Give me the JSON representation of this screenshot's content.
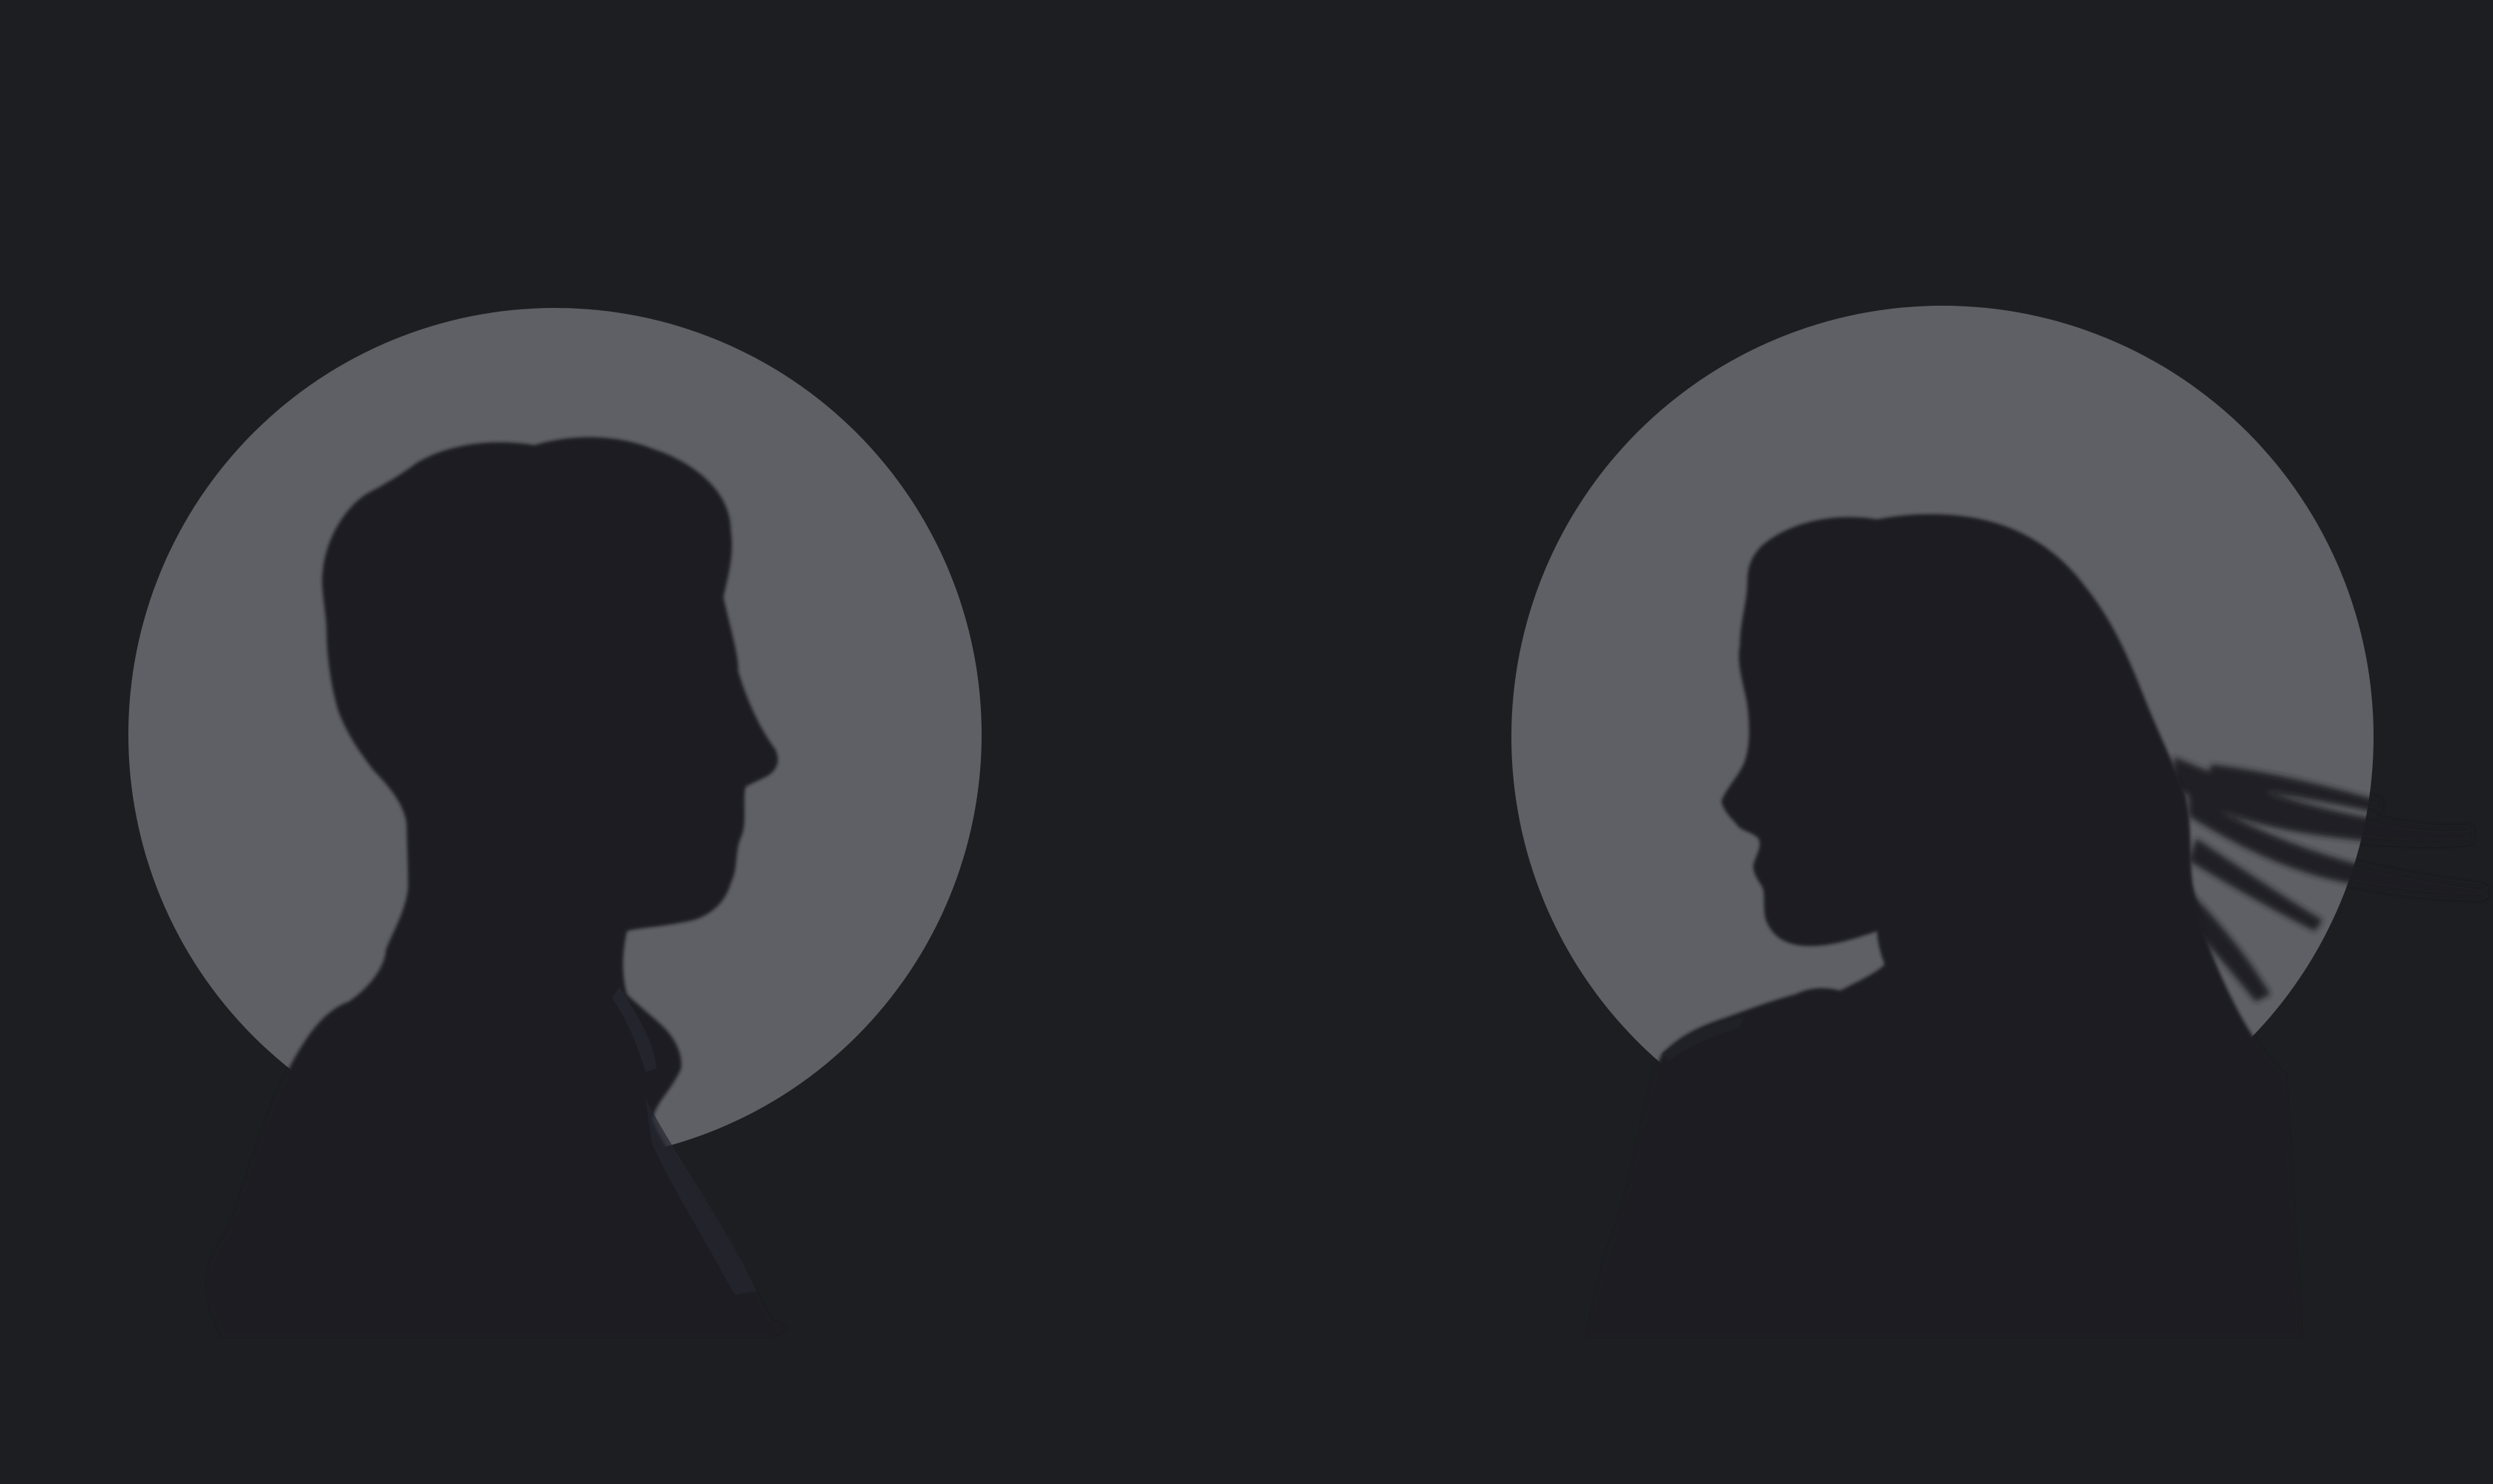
{
  "scene": {
    "background_color": "#1d1e22",
    "disc_color": "#5f6065",
    "silhouette_color": "#1c1d23",
    "figures": [
      {
        "name": "man-silhouette",
        "facing": "right"
      },
      {
        "name": "woman-silhouette",
        "facing": "left"
      }
    ]
  }
}
